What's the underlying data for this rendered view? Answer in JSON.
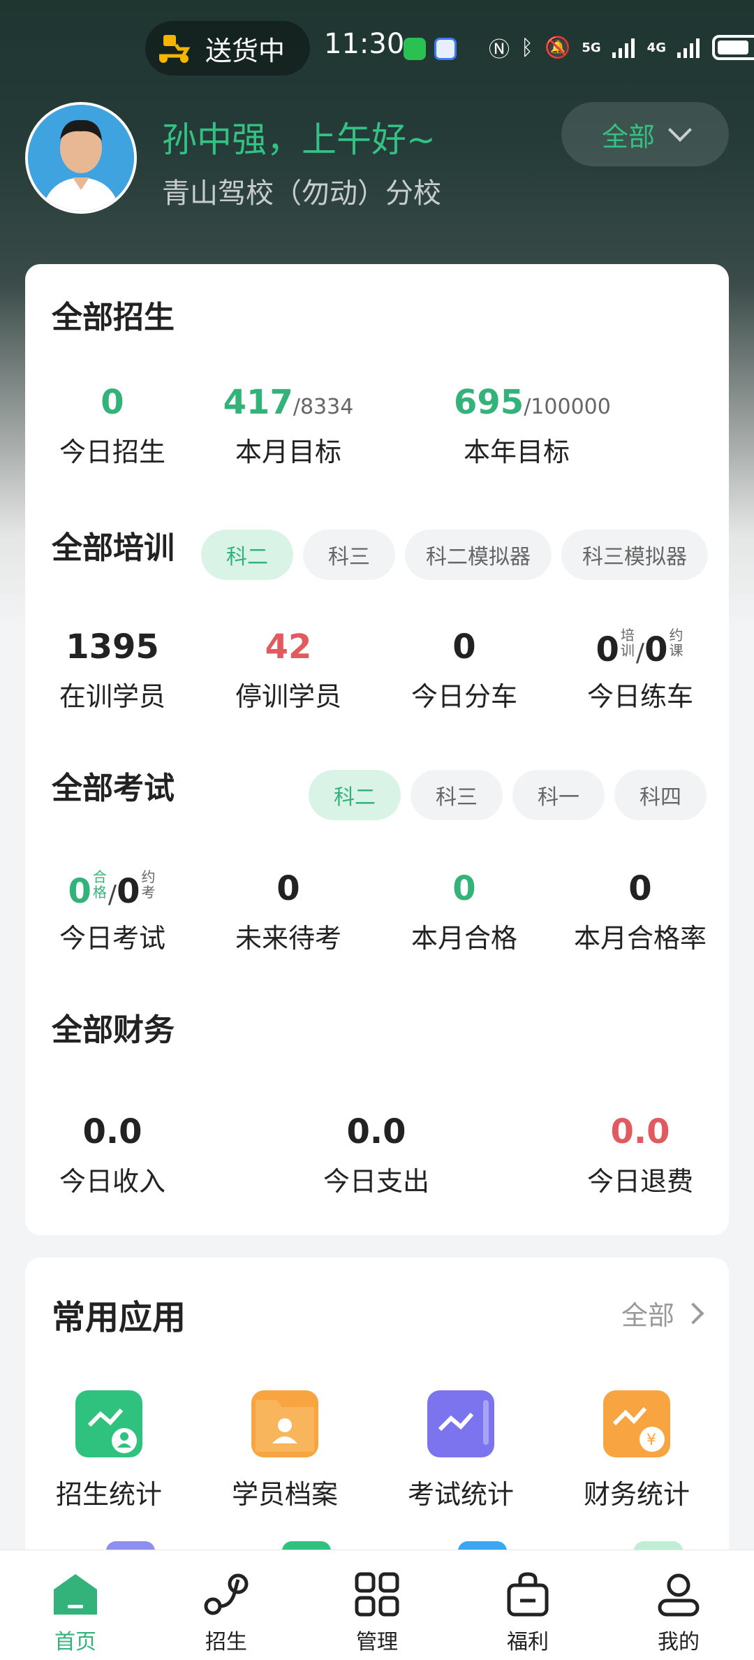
{
  "status_bar": {
    "delivery_text": "送货中",
    "time": "11:30",
    "network_5g": "5G",
    "network_4g": "4G"
  },
  "header": {
    "greeting": "孙中强，上午好~",
    "school": "青山驾校（勿动）分校",
    "filter_label": "全部"
  },
  "enrollment": {
    "title": "全部招生",
    "today": {
      "value": "0",
      "label": "今日招生"
    },
    "month": {
      "value": "417",
      "total": "/8334",
      "label": "本月目标"
    },
    "year": {
      "value": "695",
      "total": "/100000",
      "label": "本年目标"
    }
  },
  "training": {
    "title": "全部培训",
    "chips": [
      "科二",
      "科三",
      "科二模拟器",
      "科三模拟器"
    ],
    "active_chip": "科二",
    "in_training": {
      "value": "1395",
      "label": "在训学员"
    },
    "stopped": {
      "value": "42",
      "label": "停训学员"
    },
    "today_assign": {
      "value": "0",
      "label": "今日分车"
    },
    "today_practice": {
      "value_a": "0",
      "tag_a_1": "培",
      "tag_a_2": "训",
      "value_b": "0",
      "tag_b_1": "约",
      "tag_b_2": "课",
      "label": "今日练车"
    }
  },
  "exams": {
    "title": "全部考试",
    "chips": [
      "科二",
      "科三",
      "科一",
      "科四"
    ],
    "active_chip": "科二",
    "today_exam": {
      "value_a": "0",
      "tag_a_1": "合",
      "tag_a_2": "格",
      "value_b": "0",
      "tag_b_1": "约",
      "tag_b_2": "考",
      "label": "今日考试"
    },
    "upcoming": {
      "value": "0",
      "label": "未来待考"
    },
    "month_pass": {
      "value": "0",
      "label": "本月合格"
    },
    "month_pass_rate": {
      "value": "0",
      "label": "本月合格率"
    }
  },
  "finance": {
    "title": "全部财务",
    "income": {
      "value": "0.0",
      "label": "今日收入"
    },
    "expense": {
      "value": "0.0",
      "label": "今日支出"
    },
    "refund": {
      "value": "0.0",
      "label": "今日退费"
    }
  },
  "apps": {
    "title": "常用应用",
    "all_label": "全部",
    "items": [
      {
        "label": "招生统计",
        "icon": "enrollment-stats-icon",
        "color": "#2fc27e"
      },
      {
        "label": "学员档案",
        "icon": "student-file-icon",
        "color": "#f7a441"
      },
      {
        "label": "考试统计",
        "icon": "exam-stats-icon",
        "color": "#7b74ee"
      },
      {
        "label": "财务统计",
        "icon": "finance-stats-icon",
        "color": "#f7a441"
      }
    ]
  },
  "bottom_nav": {
    "items": [
      {
        "label": "首页",
        "icon": "home-icon"
      },
      {
        "label": "招生",
        "icon": "enroll-icon"
      },
      {
        "label": "管理",
        "icon": "manage-grid-icon"
      },
      {
        "label": "福利",
        "icon": "bag-icon"
      },
      {
        "label": "我的",
        "icon": "profile-icon"
      }
    ],
    "active": "首页"
  },
  "colors": {
    "accent_green": "#33b379",
    "alert_red": "#e05a5f",
    "header_dark": "#1f3530"
  }
}
